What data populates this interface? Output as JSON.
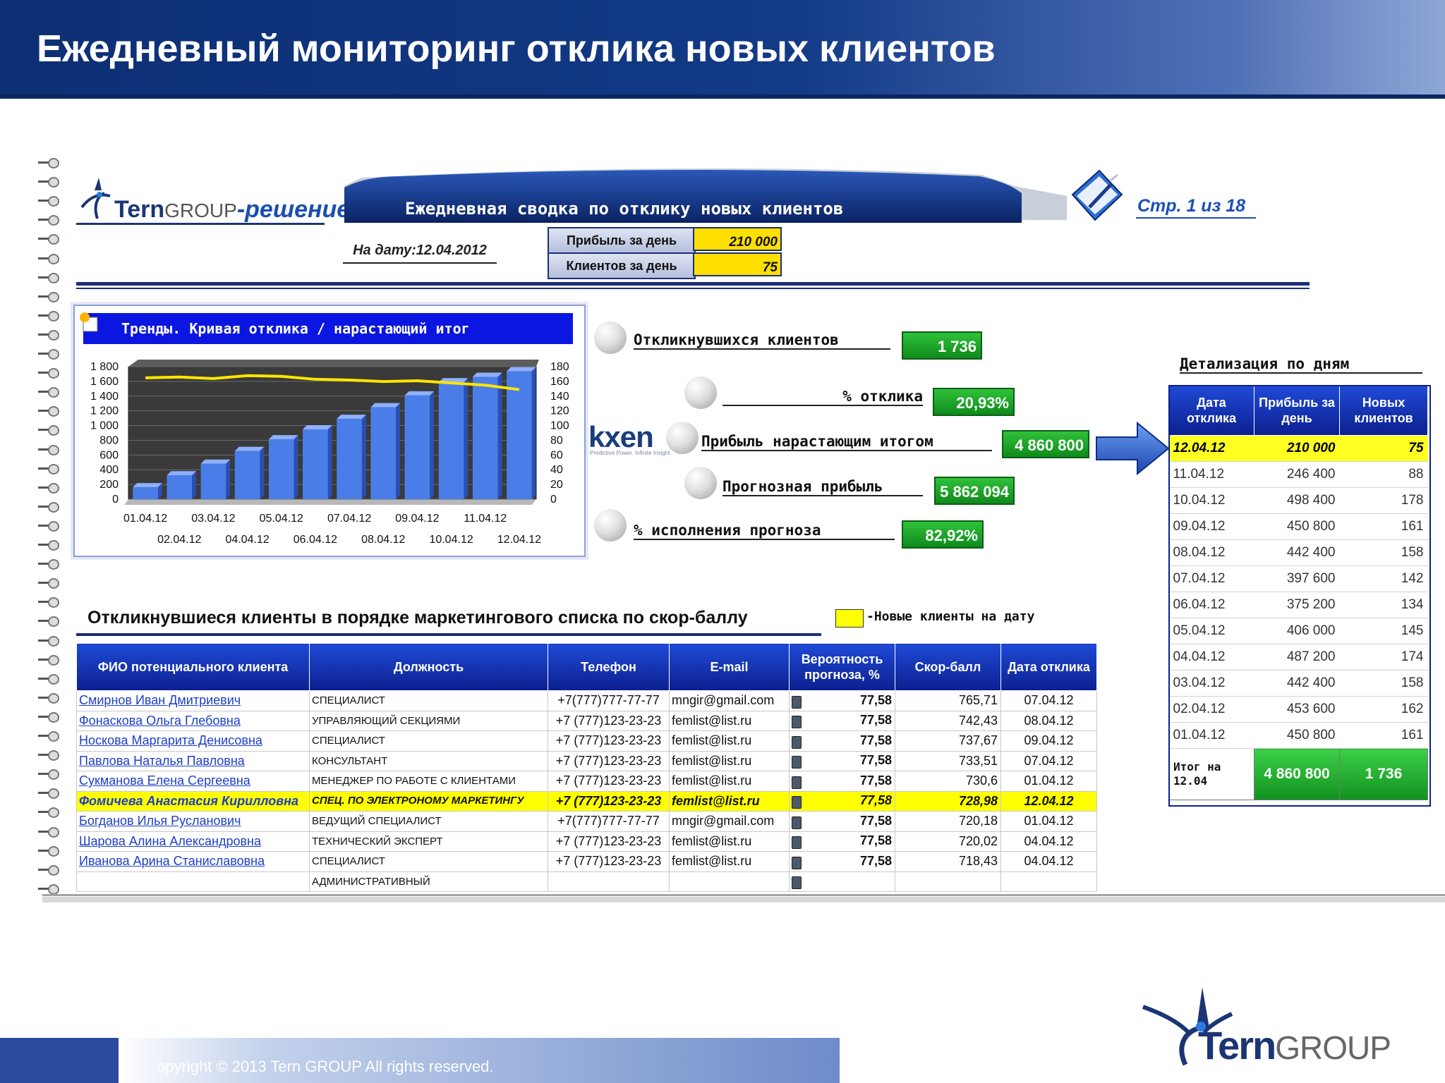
{
  "page_title": "Ежедневный мониторинг отклика новых клиентов",
  "logo": {
    "brand": "Tern",
    "group": "GROUP",
    "suffix": "-решение"
  },
  "banner": {
    "title": "Ежедневная сводка по отклику новых клиентов"
  },
  "page_num": "Стр. 1 из 18",
  "date_label": "На дату:12.04.2012",
  "kpi": [
    {
      "label": "Прибыль за день",
      "value": "210 000"
    },
    {
      "label": "Клиентов за день",
      "value": "75"
    }
  ],
  "chart_title": "Тренды. Кривая отклика / нарастающий итог",
  "chart_data": {
    "type": "bar",
    "categories": [
      "01.04.12",
      "02.04.12",
      "03.04.12",
      "04.04.12",
      "05.04.12",
      "06.04.12",
      "07.04.12",
      "08.04.12",
      "09.04.12",
      "10.04.12",
      "11.04.12",
      "12.04.12"
    ],
    "x_tick_labels_top": [
      "01.04.12",
      "03.04.12",
      "05.04.12",
      "07.04.12",
      "09.04.12",
      "11.04.12"
    ],
    "x_tick_labels_bottom": [
      "02.04.12",
      "04.04.12",
      "06.04.12",
      "08.04.12",
      "10.04.12",
      "12.04.12"
    ],
    "y_left_ticks": [
      "1 800",
      "1 600",
      "1 400",
      "1 200",
      "1 000",
      "800",
      "600",
      "400",
      "200",
      "0"
    ],
    "y_right_ticks": [
      "180",
      "160",
      "140",
      "120",
      "100",
      "80",
      "60",
      "40",
      "20",
      "0"
    ],
    "ylim": [
      0,
      1800
    ],
    "y2lim": [
      0,
      180
    ],
    "series": [
      {
        "values": [
          161,
          323,
          481,
          655,
          813,
          948,
          1090,
          1248,
          1409,
          1587,
          1661,
          1736
        ],
        "axis": "left",
        "color": "#4a7de8"
      },
      {
        "type": "line",
        "values": [
          161,
          162,
          160,
          164,
          163,
          159,
          158,
          156,
          157,
          154,
          151,
          145
        ],
        "axis": "right",
        "color": "#ffe600"
      }
    ],
    "grid": true
  },
  "metrics": [
    {
      "label": "Откликнувшихся клиентов",
      "value": "1 736"
    },
    {
      "label": "% отклика",
      "value": "20,93%"
    },
    {
      "label": "Прибыль нарастающим итогом",
      "value": "4 860 800"
    },
    {
      "label": "Прогнозная прибыль",
      "value": "5 862 094"
    },
    {
      "label": "% исполнения прогноза",
      "value": "82,92%"
    }
  ],
  "kxen": {
    "name": "kxen",
    "tagline": "Predictive Power. Infinite Insight."
  },
  "details": {
    "title": "Детализация по дням",
    "headers": [
      "Дата отклика",
      "Прибыль за день",
      "Новых клиентов"
    ],
    "rows": [
      [
        "12.04.12",
        "210 000",
        "75"
      ],
      [
        "11.04.12",
        "246 400",
        "88"
      ],
      [
        "10.04.12",
        "498 400",
        "178"
      ],
      [
        "09.04.12",
        "450 800",
        "161"
      ],
      [
        "08.04.12",
        "442 400",
        "158"
      ],
      [
        "07.04.12",
        "397 600",
        "142"
      ],
      [
        "06.04.12",
        "375 200",
        "134"
      ],
      [
        "05.04.12",
        "406 000",
        "145"
      ],
      [
        "04.04.12",
        "487 200",
        "174"
      ],
      [
        "03.04.12",
        "442 400",
        "158"
      ],
      [
        "02.04.12",
        "453 600",
        "162"
      ],
      [
        "01.04.12",
        "450 800",
        "161"
      ]
    ],
    "total": {
      "label": "Итог на 12.04",
      "profit": "4 860 800",
      "clients": "1 736"
    }
  },
  "list": {
    "title": "Откликнувшиеся клиенты в порядке маркетингового списка по скор-баллу",
    "legend": "-Новые клиенты на дату",
    "headers": [
      "ФИО потенциального клиента",
      "Должность",
      "Телефон",
      "E-mail",
      "Вероятность прогноза, %",
      "Скор-балл",
      "Дата отклика"
    ],
    "rows": [
      {
        "name": "Смирнов Иван Дмитриевич",
        "position": "специалист",
        "phone": "+7(777)777-77-77",
        "email": "mngir@gmail.com",
        "prob": "77,58",
        "score": "765,71",
        "date": "07.04.12"
      },
      {
        "name": "Фонаскова Ольга Глебовна",
        "position": "управляющий секциями",
        "phone": "+7 (777)123-23-23",
        "email": "femlist@list.ru",
        "prob": "77,58",
        "score": "742,43",
        "date": "08.04.12"
      },
      {
        "name": "Носкова Маргарита Денисовна",
        "position": "специалист",
        "phone": "+7 (777)123-23-23",
        "email": "femlist@list.ru",
        "prob": "77,58",
        "score": "737,67",
        "date": "09.04.12"
      },
      {
        "name": "Павлова Наталья Павловна",
        "position": "консультант",
        "phone": "+7 (777)123-23-23",
        "email": "femlist@list.ru",
        "prob": "77,58",
        "score": "733,51",
        "date": "07.04.12"
      },
      {
        "name": "Сукманова Елена Сергеевна",
        "position": "менеджер по работе с клиентами",
        "phone": "+7 (777)123-23-23",
        "email": "femlist@list.ru",
        "prob": "77,58",
        "score": "730,6",
        "date": "01.04.12"
      },
      {
        "name": "Фомичева Анастасия Кирилловна",
        "position": "спец. по электроному маркетингу",
        "phone": "+7 (777)123-23-23",
        "email": "femlist@list.ru",
        "prob": "77,58",
        "score": "728,98",
        "date": "12.04.12",
        "highlight": true
      },
      {
        "name": "Богданов Илья Русланович",
        "position": "ведущий специалист",
        "phone": "+7(777)777-77-77",
        "email": "mngir@gmail.com",
        "prob": "77,58",
        "score": "720,18",
        "date": "01.04.12"
      },
      {
        "name": "Шарова Алина Александровна",
        "position": "технический эксперт",
        "phone": "+7 (777)123-23-23",
        "email": "femlist@list.ru",
        "prob": "77,58",
        "score": "720,02",
        "date": "04.04.12"
      },
      {
        "name": "Иванова Арина Станиславовна",
        "position": "специалист",
        "phone": "+7 (777)123-23-23",
        "email": "femlist@list.ru",
        "prob": "77,58",
        "score": "718,43",
        "date": "04.04.12"
      },
      {
        "name": "",
        "position": "административный",
        "phone": "",
        "email": "",
        "prob": "",
        "score": "",
        "date": ""
      }
    ]
  },
  "footer": {
    "copyright": "opyright © 2013 Tern GROUP All rights reserved."
  },
  "colors": {
    "header_blue": "#123a86",
    "kpi_yellow": "#ffdf00",
    "metric_green": "#1aa52a",
    "table_blue": "#0c1f8f",
    "highlight_yellow": "#ffff00"
  }
}
